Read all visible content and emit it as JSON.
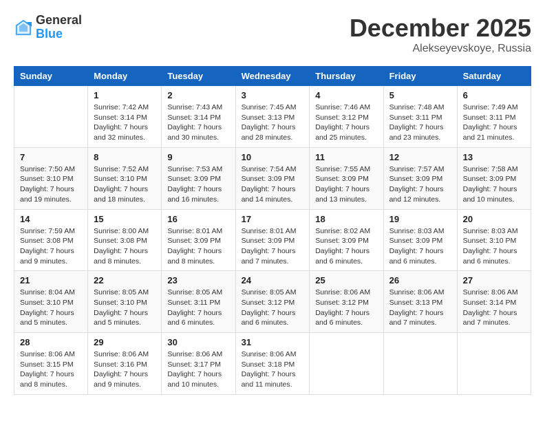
{
  "header": {
    "logo_general": "General",
    "logo_blue": "Blue",
    "month_title": "December 2025",
    "location": "Alekseyevskoye, Russia"
  },
  "days_of_week": [
    "Sunday",
    "Monday",
    "Tuesday",
    "Wednesday",
    "Thursday",
    "Friday",
    "Saturday"
  ],
  "weeks": [
    [
      {
        "day": "",
        "info": ""
      },
      {
        "day": "1",
        "info": "Sunrise: 7:42 AM\nSunset: 3:14 PM\nDaylight: 7 hours\nand 32 minutes."
      },
      {
        "day": "2",
        "info": "Sunrise: 7:43 AM\nSunset: 3:14 PM\nDaylight: 7 hours\nand 30 minutes."
      },
      {
        "day": "3",
        "info": "Sunrise: 7:45 AM\nSunset: 3:13 PM\nDaylight: 7 hours\nand 28 minutes."
      },
      {
        "day": "4",
        "info": "Sunrise: 7:46 AM\nSunset: 3:12 PM\nDaylight: 7 hours\nand 25 minutes."
      },
      {
        "day": "5",
        "info": "Sunrise: 7:48 AM\nSunset: 3:11 PM\nDaylight: 7 hours\nand 23 minutes."
      },
      {
        "day": "6",
        "info": "Sunrise: 7:49 AM\nSunset: 3:11 PM\nDaylight: 7 hours\nand 21 minutes."
      }
    ],
    [
      {
        "day": "7",
        "info": "Sunrise: 7:50 AM\nSunset: 3:10 PM\nDaylight: 7 hours\nand 19 minutes."
      },
      {
        "day": "8",
        "info": "Sunrise: 7:52 AM\nSunset: 3:10 PM\nDaylight: 7 hours\nand 18 minutes."
      },
      {
        "day": "9",
        "info": "Sunrise: 7:53 AM\nSunset: 3:09 PM\nDaylight: 7 hours\nand 16 minutes."
      },
      {
        "day": "10",
        "info": "Sunrise: 7:54 AM\nSunset: 3:09 PM\nDaylight: 7 hours\nand 14 minutes."
      },
      {
        "day": "11",
        "info": "Sunrise: 7:55 AM\nSunset: 3:09 PM\nDaylight: 7 hours\nand 13 minutes."
      },
      {
        "day": "12",
        "info": "Sunrise: 7:57 AM\nSunset: 3:09 PM\nDaylight: 7 hours\nand 12 minutes."
      },
      {
        "day": "13",
        "info": "Sunrise: 7:58 AM\nSunset: 3:09 PM\nDaylight: 7 hours\nand 10 minutes."
      }
    ],
    [
      {
        "day": "14",
        "info": "Sunrise: 7:59 AM\nSunset: 3:08 PM\nDaylight: 7 hours\nand 9 minutes."
      },
      {
        "day": "15",
        "info": "Sunrise: 8:00 AM\nSunset: 3:08 PM\nDaylight: 7 hours\nand 8 minutes."
      },
      {
        "day": "16",
        "info": "Sunrise: 8:01 AM\nSunset: 3:09 PM\nDaylight: 7 hours\nand 8 minutes."
      },
      {
        "day": "17",
        "info": "Sunrise: 8:01 AM\nSunset: 3:09 PM\nDaylight: 7 hours\nand 7 minutes."
      },
      {
        "day": "18",
        "info": "Sunrise: 8:02 AM\nSunset: 3:09 PM\nDaylight: 7 hours\nand 6 minutes."
      },
      {
        "day": "19",
        "info": "Sunrise: 8:03 AM\nSunset: 3:09 PM\nDaylight: 7 hours\nand 6 minutes."
      },
      {
        "day": "20",
        "info": "Sunrise: 8:03 AM\nSunset: 3:10 PM\nDaylight: 7 hours\nand 6 minutes."
      }
    ],
    [
      {
        "day": "21",
        "info": "Sunrise: 8:04 AM\nSunset: 3:10 PM\nDaylight: 7 hours\nand 5 minutes."
      },
      {
        "day": "22",
        "info": "Sunrise: 8:05 AM\nSunset: 3:10 PM\nDaylight: 7 hours\nand 5 minutes."
      },
      {
        "day": "23",
        "info": "Sunrise: 8:05 AM\nSunset: 3:11 PM\nDaylight: 7 hours\nand 6 minutes."
      },
      {
        "day": "24",
        "info": "Sunrise: 8:05 AM\nSunset: 3:12 PM\nDaylight: 7 hours\nand 6 minutes."
      },
      {
        "day": "25",
        "info": "Sunrise: 8:06 AM\nSunset: 3:12 PM\nDaylight: 7 hours\nand 6 minutes."
      },
      {
        "day": "26",
        "info": "Sunrise: 8:06 AM\nSunset: 3:13 PM\nDaylight: 7 hours\nand 7 minutes."
      },
      {
        "day": "27",
        "info": "Sunrise: 8:06 AM\nSunset: 3:14 PM\nDaylight: 7 hours\nand 7 minutes."
      }
    ],
    [
      {
        "day": "28",
        "info": "Sunrise: 8:06 AM\nSunset: 3:15 PM\nDaylight: 7 hours\nand 8 minutes."
      },
      {
        "day": "29",
        "info": "Sunrise: 8:06 AM\nSunset: 3:16 PM\nDaylight: 7 hours\nand 9 minutes."
      },
      {
        "day": "30",
        "info": "Sunrise: 8:06 AM\nSunset: 3:17 PM\nDaylight: 7 hours\nand 10 minutes."
      },
      {
        "day": "31",
        "info": "Sunrise: 8:06 AM\nSunset: 3:18 PM\nDaylight: 7 hours\nand 11 minutes."
      },
      {
        "day": "",
        "info": ""
      },
      {
        "day": "",
        "info": ""
      },
      {
        "day": "",
        "info": ""
      }
    ]
  ]
}
